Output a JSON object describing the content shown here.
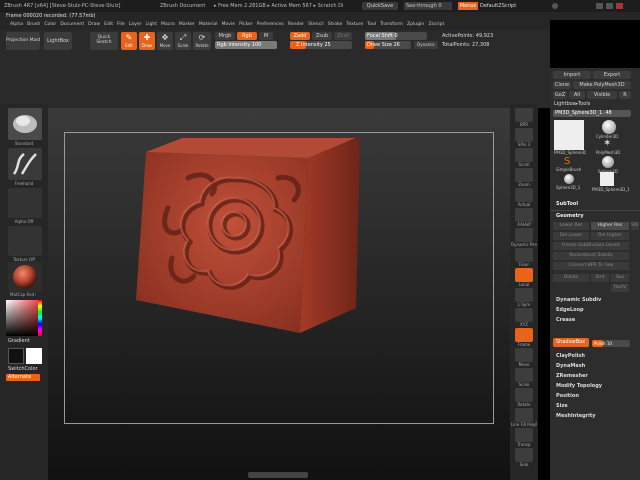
{
  "app": {
    "title_left": "ZBrush 4R7 [x64] [Steve-Stulz-PC-Steve-Stulz]",
    "title_doc": "ZBrush Document",
    "title_mem": "▸ Free Mem 2.281GB ▸ Active Mem 567 ▸ Scratch Di",
    "quicksave": "QuickSave",
    "see_through": "See-through   0",
    "menus_btn": "Menus",
    "default_script": "DefaultZScript",
    "status_msg": "Frame 000020 recorded. (77.57mb)"
  },
  "menubar": {
    "items": [
      "Alpha",
      "Brush",
      "Color",
      "Document",
      "Draw",
      "Edit",
      "File",
      "Layer",
      "Light",
      "Macro",
      "Marker",
      "Material",
      "Movie",
      "Picker",
      "Preferences",
      "Render",
      "Stencil",
      "Stroke",
      "Texture",
      "Tool",
      "Transform",
      "Zplugin",
      "Zscript"
    ]
  },
  "toolbar": {
    "projection_master": "Projection Master",
    "lightbox": "LightBox",
    "quick_sketch": "Quick Sketch",
    "edit": "Edit",
    "draw": "Draw",
    "move": "Move",
    "scale": "Scale",
    "rotate": "Rotate",
    "mrgb": "Mrgb",
    "rgb": "Rgb",
    "m": "M",
    "rgb_intensity": "Rgb Intensity 100",
    "zadd": "Zadd",
    "zsub": "Zsub",
    "zcut": "Zcut",
    "z_intensity": "Z Intensity 25",
    "focal_shift": "Focal Shift 0",
    "draw_size": "Draw Size 26",
    "dynamic": "Dynamic",
    "active_points": "ActivePoints: 49,923",
    "total_points": "TotalPoints: 27,308"
  },
  "left_shelf": {
    "brush_label": "Standard",
    "stroke_label": "Freehand",
    "alpha_label": "Alpha Off",
    "texture_label": "Texture Off",
    "material_label": "MatCap Red 01",
    "gradient_label": "Gradient",
    "switch_color": "SwitchColor",
    "alternate": "Alternate"
  },
  "right_shelf": {
    "items": [
      "BPR",
      "SPix 3",
      "Scroll",
      "Zoom",
      "Actual",
      "AAHalf",
      "Dynamic Persp",
      "Floor",
      "Local",
      "L.Sym",
      "XYZ",
      "Frame",
      "Move",
      "Scale",
      "Rotate",
      "Line Fill PolyF",
      "Transp",
      "Solo"
    ]
  },
  "tool_panel": {
    "import": "Import",
    "export": "Export",
    "clone": "Clone",
    "make_polymesh": "Make PolyMesh3D",
    "goz": "GoZ",
    "all": "All",
    "visible": "Visible",
    "r": "R",
    "lightbox_tools": "Lightbox▸Tools",
    "current_tool": "PM3D_Sphere3D_1. 48",
    "thumbs": [
      {
        "label": "PM3D_Sphere3D_1"
      },
      {
        "label": "Cylinder3D"
      },
      {
        "label": "PolyMesh3D"
      },
      {
        "label": "SimpleBrush"
      },
      {
        "label": "Sphere3D"
      },
      {
        "label": "Sphere3D_1"
      },
      {
        "label": "PM3D_Sphere3D_1"
      }
    ],
    "subtool": "SubTool",
    "geometry": "Geometry",
    "lower_res": "Lower Res",
    "higher_res": "Higher Res",
    "sdiv": "SDiv",
    "del_lower": "Del Lower",
    "del_higher": "Del Higher",
    "freeze_subdiv": "Freeze SubDivision Levels",
    "reconstruct_subdiv": "Reconstruct Subdiv",
    "convert_bpr": "Convert BPR To Geo",
    "divide": "Divide",
    "smt": "Smt",
    "suv": "Suv",
    "rsmt": "ReUV",
    "dynamic_subdiv": "Dynamic Subdiv",
    "edgeloop": "EdgeLoop",
    "crease": "Crease",
    "shadowbox": "ShadowBox",
    "claypolish": "ClayPolish",
    "polish": "Polish 10",
    "dynamesh": "DynaMesh",
    "zremesher": "ZRemesher",
    "modify_topology": "Modify Topology",
    "position": "Position",
    "size": "Size",
    "meshintegrity": "MeshIntegrity"
  },
  "colors": {
    "accent": "#e8641b",
    "cube_face": "#b5442f",
    "cube_side": "#8e3322",
    "cube_top": "#a53d2a"
  }
}
